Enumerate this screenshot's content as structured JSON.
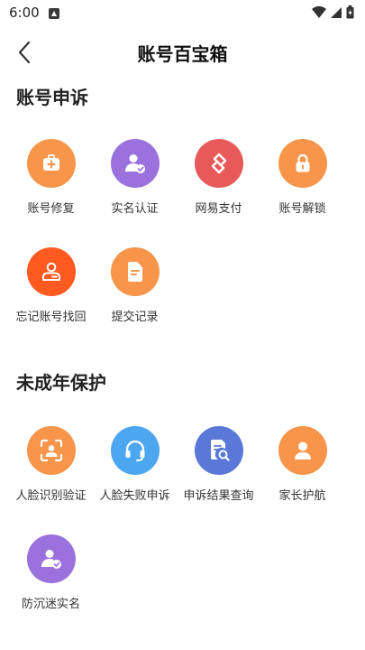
{
  "status": {
    "time": "6:00"
  },
  "header": {
    "title": "账号百宝箱"
  },
  "colors": {
    "orange": "#F7954A",
    "purple": "#9B71DD",
    "red": "#E85A5A",
    "deep_orange": "#FF5A1F",
    "blue": "#4DA6F0",
    "indigo": "#5A78D8"
  },
  "sections": [
    {
      "title": "账号申诉",
      "items": [
        {
          "label": "账号修复",
          "icon": "medical-kit-icon",
          "color": "#F7954A"
        },
        {
          "label": "实名认证",
          "icon": "user-verified-icon",
          "color": "#9B71DD"
        },
        {
          "label": "网易支付",
          "icon": "netease-pay-icon",
          "color": "#E85A5A"
        },
        {
          "label": "账号解锁",
          "icon": "unlock-icon",
          "color": "#F7954A"
        },
        {
          "label": "忘记账号找回",
          "icon": "id-card-icon",
          "color": "#FF5A1F"
        },
        {
          "label": "提交记录",
          "icon": "document-icon",
          "color": "#F7954A"
        }
      ]
    },
    {
      "title": "未成年保护",
      "items": [
        {
          "label": "人脸识别验证",
          "icon": "face-scan-icon",
          "color": "#F7954A"
        },
        {
          "label": "人脸失败申诉",
          "icon": "headset-icon",
          "color": "#4DA6F0"
        },
        {
          "label": "申诉结果查询",
          "icon": "document-search-icon",
          "color": "#5A78D8"
        },
        {
          "label": "家长护航",
          "icon": "parent-user-icon",
          "color": "#F7954A"
        },
        {
          "label": "防沉迷实名",
          "icon": "user-verified-icon",
          "color": "#9B71DD"
        }
      ]
    }
  ]
}
